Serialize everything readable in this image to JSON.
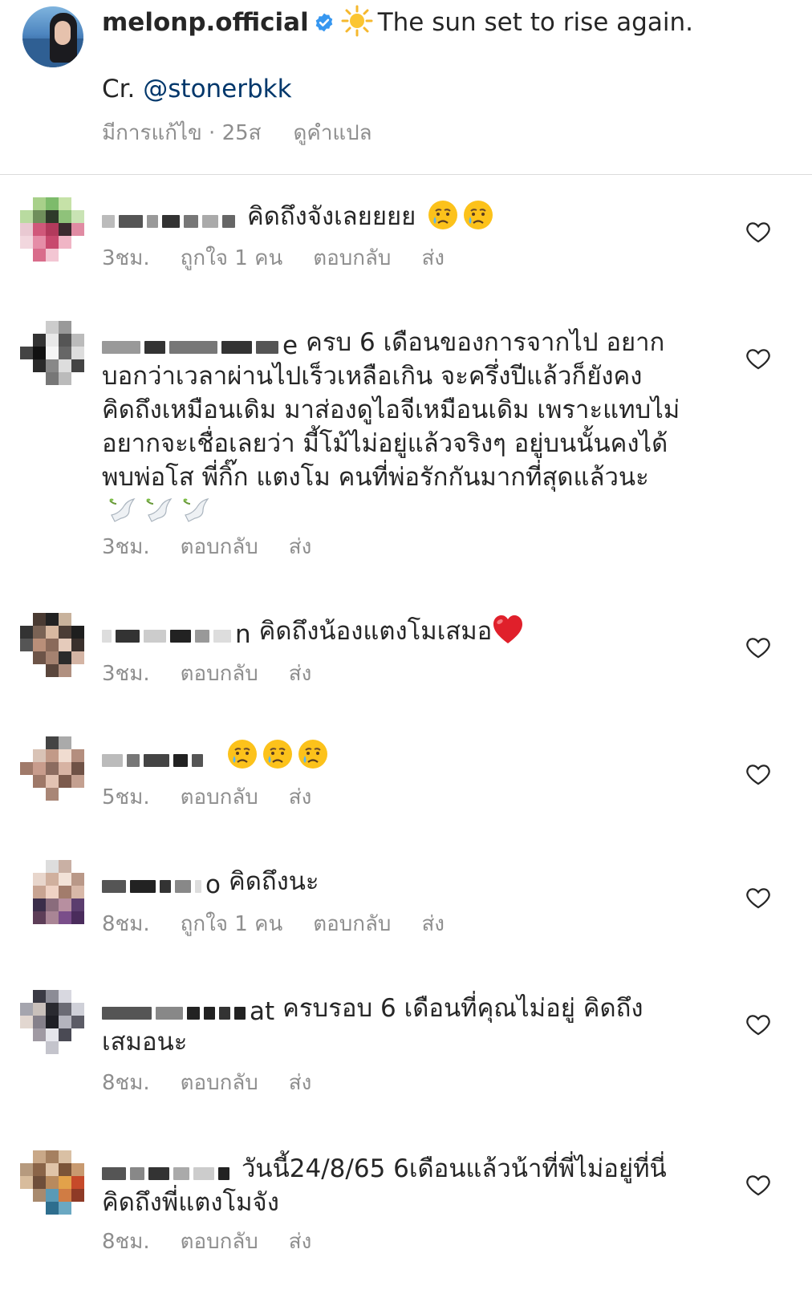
{
  "caption": {
    "username": "melonp.official",
    "text": "The sun set to rise again.",
    "credit_prefix": "Cr. ",
    "mention": "@stonerbkk",
    "edited": "มีการแก้ไข · 25ส",
    "translate": "ดูคำแปล",
    "icons": [
      "verified-badge-icon",
      "sun-emoji"
    ]
  },
  "colors": {
    "text": "#262626",
    "muted": "#8e8e8e",
    "link": "#00376b",
    "verified": "#3797f0",
    "divider": "#dbdbdb"
  },
  "comments": [
    {
      "handle": "",
      "text": "คิดถึงจังเลยยยย",
      "time": "3ชม.",
      "likes": "ถูกใจ 1 คน",
      "reply": "ตอบกลับ",
      "send": "ส่ง",
      "emojis": [
        "crying-face",
        "crying-face"
      ]
    },
    {
      "handle": "e",
      "text": "ครบ 6 เดือนของการจากไป อยากบอกว่าเวลาผ่านไปเร็วเหลือเกิน จะครึ่งปีแล้วก็ยังคง คิดถึงเหมือนเดิม มาส่องดูไอจีเหมือนเดิม เพราะแทบไม่ อยากจะเชื่อเลยว่า มี้โม้ไม่อยู่แล้วจริงๆ  อยู่บนนั้นคงได้ พบพ่อโส พี่กิ๊ก แตงโม คนที่พ่อรักกันมากที่สุดแล้วนะ",
      "time": "3ชม.",
      "reply": "ตอบกลับ",
      "send": "ส่ง",
      "emojis": [
        "dove",
        "dove",
        "dove"
      ]
    },
    {
      "handle": "n",
      "text": "คิดถึงน้องแตงโมเสมอ",
      "time": "3ชม.",
      "reply": "ตอบกลับ",
      "send": "ส่ง",
      "emojis": [
        "red-heart"
      ]
    },
    {
      "handle": "",
      "text": "",
      "time": "5ชม.",
      "reply": "ตอบกลับ",
      "send": "ส่ง",
      "emojis": [
        "crying-face",
        "crying-face",
        "crying-face"
      ]
    },
    {
      "handle": "o",
      "text": "คิดถึงนะ",
      "time": "8ชม.",
      "likes": "ถูกใจ 1 คน",
      "reply": "ตอบกลับ",
      "send": "ส่ง"
    },
    {
      "handle": "at",
      "text": "ครบรอบ 6 เดือนที่คุณไม่อยู่ คิดถึงเสมอนะ",
      "time": "8ชม.",
      "reply": "ตอบกลับ",
      "send": "ส่ง"
    },
    {
      "handle": "",
      "text": "วันนี้24/8/65 6เดือนแล้วน้าที่พี่ไม่อยู่ที่นี่ คิดถึงพี่แตงโมจัง",
      "time": "8ชม.",
      "reply": "ตอบกลับ",
      "send": "ส่ง"
    }
  ]
}
